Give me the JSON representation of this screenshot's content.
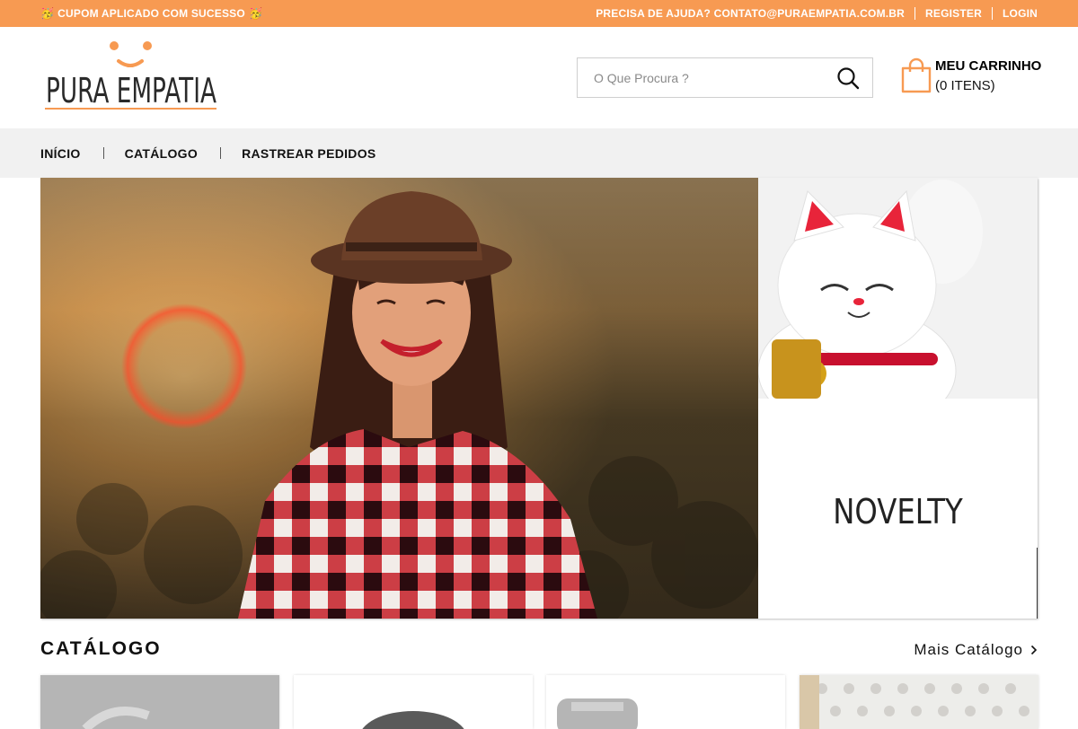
{
  "topbar": {
    "promo_text": "CUPOM APLICADO COM SUCESSO",
    "promo_emoji_left": "🥳",
    "promo_emoji_right": "🥳",
    "help_text": "PRECISA DE AJUDA? CONTATO@PURAEMPATIA.COM.BR",
    "register_label": "REGISTER",
    "login_label": "LOGIN",
    "background_color": "#f79a52"
  },
  "header": {
    "logo_text": "PURA EMPATIA",
    "logo_accent_color": "#f79a52",
    "search": {
      "placeholder": "O Que Procura ?",
      "value": "",
      "icon": "search-icon"
    },
    "cart": {
      "title": "MEU CARRINHO",
      "count_text": "(0 ITENS)",
      "icon": "shopping-bag-icon"
    }
  },
  "nav": {
    "items": [
      {
        "label": "INÍCIO"
      },
      {
        "label": "CATÁLOGO"
      },
      {
        "label": "RASTREAR PEDIDOS"
      }
    ]
  },
  "hero": {
    "novelty_text": "NOVELTY"
  },
  "catalog": {
    "title": "CATÁLOGO",
    "more_label": "Mais Catálogo",
    "more_icon": "chevron-right-icon"
  }
}
